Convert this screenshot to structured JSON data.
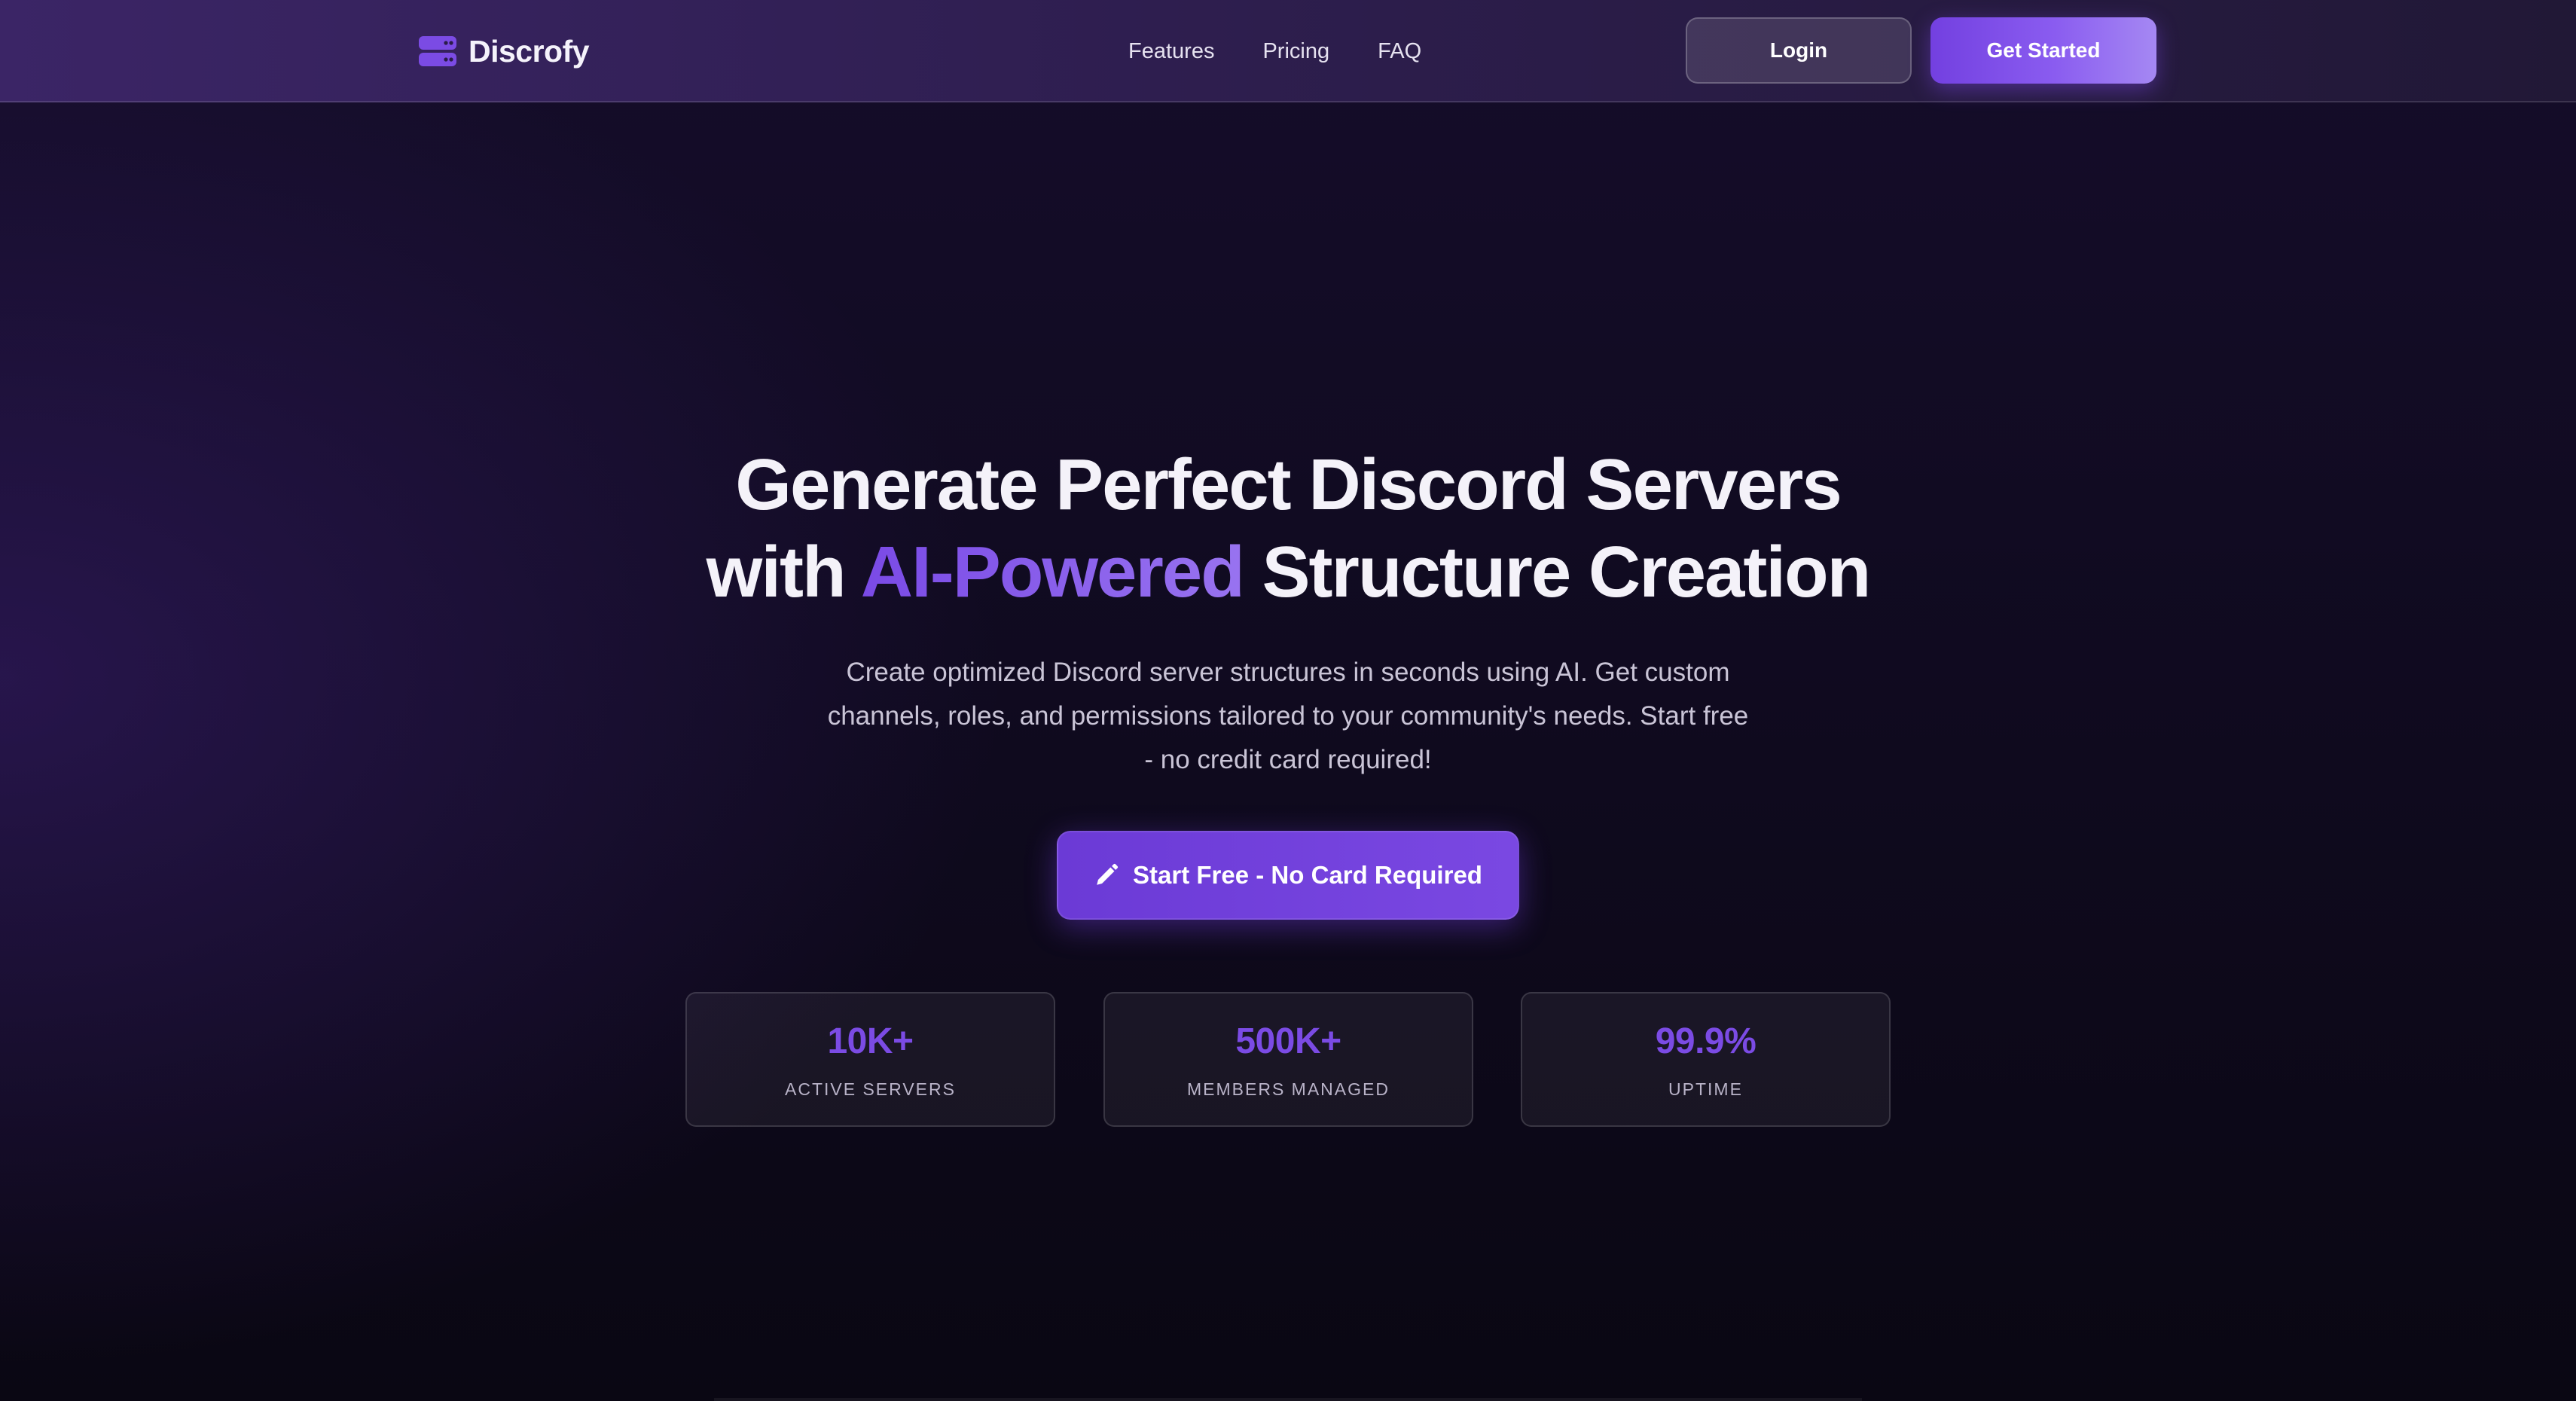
{
  "navbar": {
    "brand": "Discrofy",
    "brand_icon": "server-stack-icon",
    "links": [
      "Features",
      "Pricing",
      "FAQ"
    ],
    "login_label": "Login",
    "get_started_label": "Get Started"
  },
  "hero": {
    "title_line1": "Generate Perfect Discord Servers",
    "title_line2_before": "with ",
    "title_highlight": "AI-Powered",
    "title_line2_after": " Structure Creation",
    "subtitle": "Create optimized Discord server structures in seconds using AI. Get custom channels, roles, and permissions tailored to your community's needs. Start free - no credit card required!",
    "cta_label": "Start Free - No Card Required",
    "cta_icon": "pencil-icon"
  },
  "stats": [
    {
      "value": "10K+",
      "label": "ACTIVE SERVERS"
    },
    {
      "value": "500K+",
      "label": "MEMBERS MANAGED"
    },
    {
      "value": "99.9%",
      "label": "UPTIME"
    }
  ],
  "colors": {
    "accent": "#7b4be4",
    "background": "#0b0814",
    "navbar": "#2e1e4f"
  }
}
